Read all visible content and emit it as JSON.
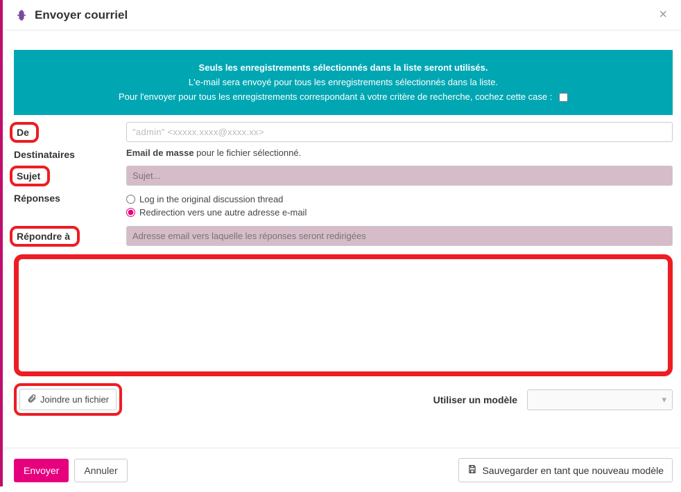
{
  "header": {
    "title": "Envoyer courriel"
  },
  "banner": {
    "line1": "Seuls les enregistrements sélectionnés dans la liste seront utilisés.",
    "line2": "L'e-mail sera envoyé pour tous les enregistrements sélectionnés dans la liste.",
    "line3_prefix": "Pour l'envoyer pour tous les enregistrements correspondant à votre critère de recherche, cochez cette case :"
  },
  "labels": {
    "from": "De",
    "recipients": "Destinataires",
    "subject": "Sujet",
    "replies": "Réponses",
    "reply_to": "Répondre à",
    "use_template": "Utiliser un modèle"
  },
  "from": {
    "display": "\"admin\" <xxxxx.xxxx@xxxx.xx>"
  },
  "recipients": {
    "bold": "Email de masse",
    "rest": " pour le fichier sélectionné."
  },
  "subject": {
    "placeholder": "Sujet..."
  },
  "replies": {
    "option_log": "Log in the original discussion thread",
    "option_redirect": "Redirection vers une autre adresse e-mail"
  },
  "reply_to": {
    "placeholder": "Adresse email vers laquelle les réponses seront redirigées"
  },
  "attach": {
    "label": "Joindre un fichier"
  },
  "footer": {
    "send": "Envoyer",
    "cancel": "Annuler",
    "save_template": "Sauvegarder en tant que nouveau modèle"
  }
}
